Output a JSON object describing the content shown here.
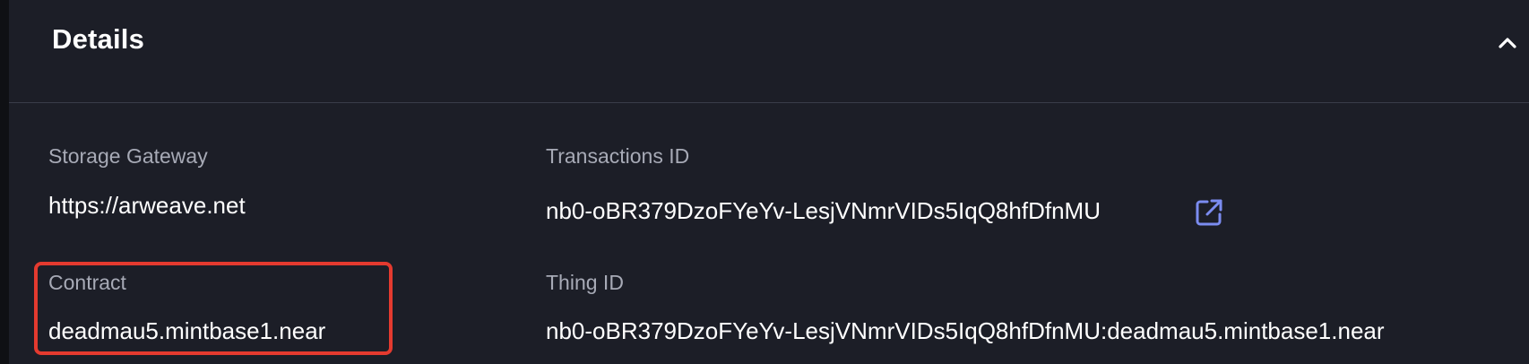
{
  "section": {
    "title": "Details",
    "collapse_icon": "chevron-up-icon"
  },
  "fields": {
    "storage_gateway": {
      "label": "Storage Gateway",
      "value": "https://arweave.net"
    },
    "transactions_id": {
      "label": "Transactions ID",
      "value": "nb0-oBR379DzoFYeYv-LesjVNmrVIDs5IqQ8hfDfnMU",
      "link_icon": "external-link-icon"
    },
    "contract": {
      "label": "Contract",
      "value": "deadmau5.mintbase1.near"
    },
    "thing_id": {
      "label": "Thing ID",
      "value": "nb0-oBR379DzoFYeYv-LesjVNmrVIDs5IqQ8hfDfnMU:deadmau5.mintbase1.near"
    }
  },
  "colors": {
    "background": "#1c1e27",
    "label": "#a7aab6",
    "value": "#ffffff",
    "link_icon": "#7b8cf0",
    "highlight_border": "#e43a2f"
  }
}
